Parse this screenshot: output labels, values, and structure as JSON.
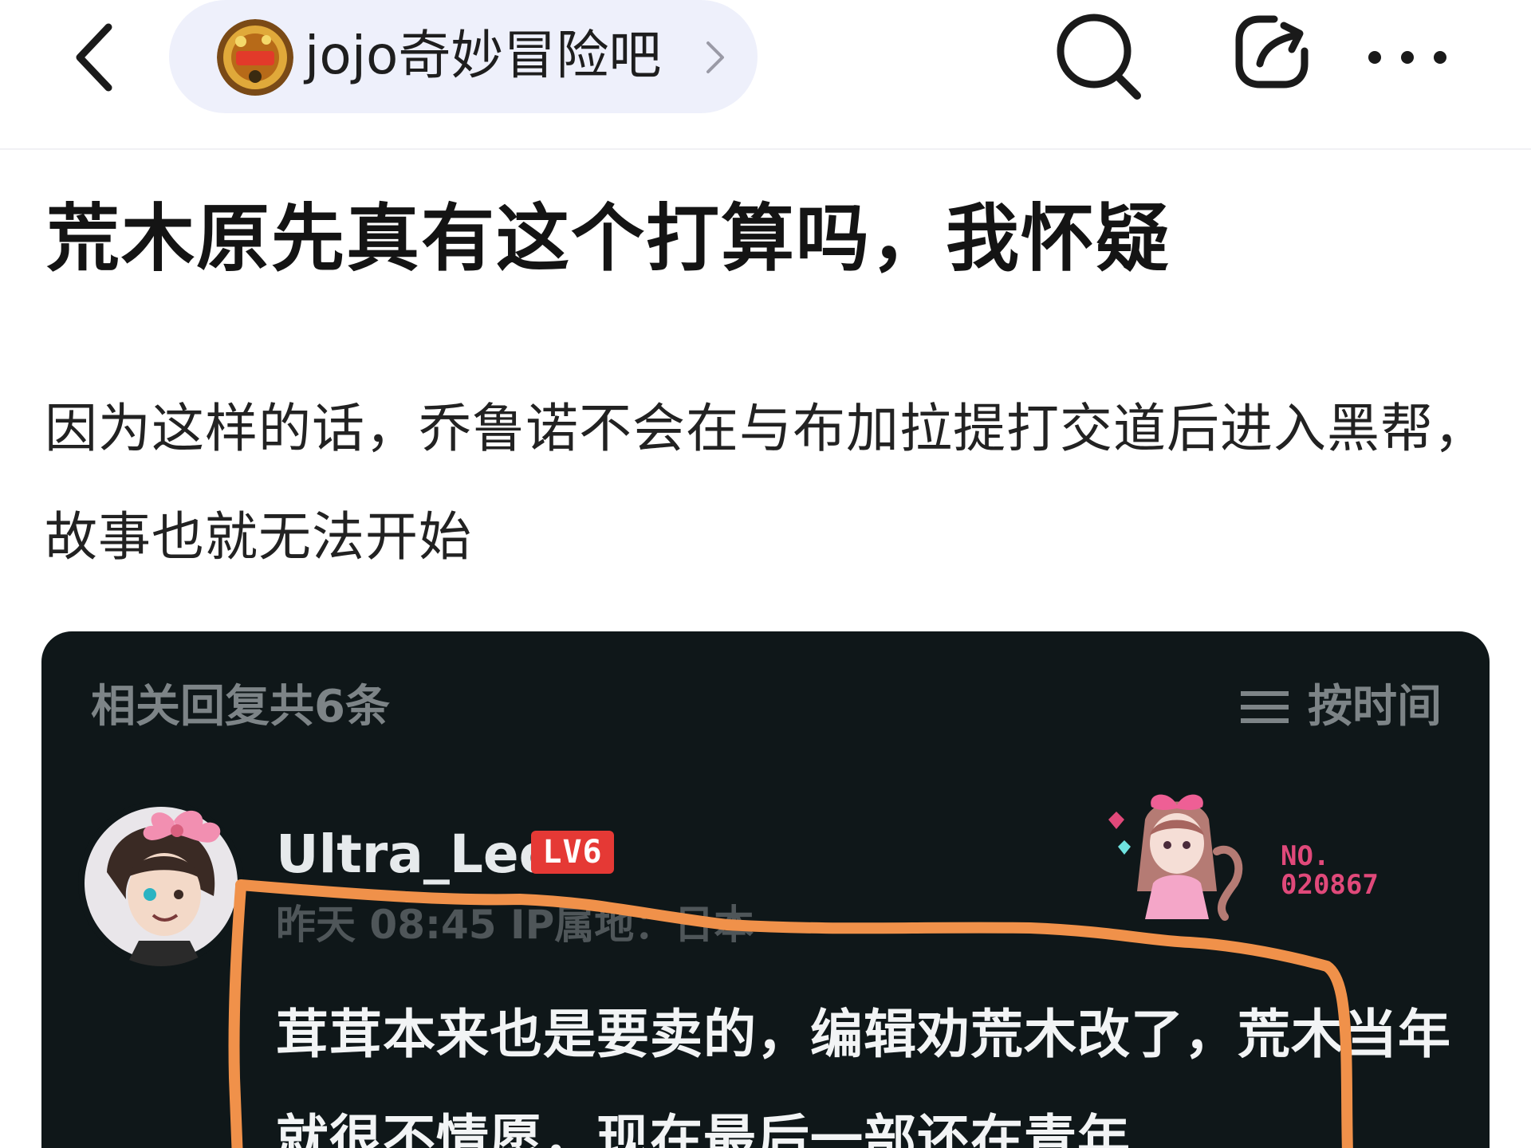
{
  "header": {
    "forum_name": "jojo奇妙冒险吧",
    "icons": {
      "back": "back-arrow-icon",
      "search": "search-icon",
      "share": "share-icon",
      "more": "more-dots-icon",
      "forward": "chevron-right-icon"
    }
  },
  "post": {
    "title": "荒木原先真有这个打算吗，我怀疑",
    "body": "因为这样的话，乔鲁诺不会在与布加拉提打交道后进入黑帮，故事也就无法开始"
  },
  "reply_card": {
    "reply_count": "相关回复共6条",
    "sort_label": "按时间",
    "reply": {
      "username": "Ultra_Leo",
      "level": "LV6",
      "meta": "昨天 08:45 IP属地：日本",
      "no_label": "NO.",
      "no_number": "020867",
      "content": "茸茸本来也是要卖的，编辑劝荒木改了，荒木当年就很不情愿，现在最后一部还在青年"
    }
  },
  "colors": {
    "pill_background": "#eef0fb",
    "card_background": "#0f1719",
    "level_badge": "#e53935",
    "annotation_stroke": "#f0914a",
    "number_badge": "#e0497a"
  }
}
